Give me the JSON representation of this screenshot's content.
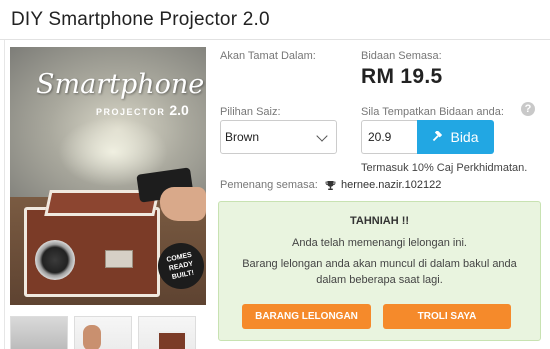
{
  "title": "DIY Smartphone Projector 2.0",
  "product_image": {
    "brand": "Smartphone",
    "subtitle": "PROJECTOR",
    "version": "2.0",
    "badge": "COMES READY BUILT!"
  },
  "thumbnails": [
    "thumbnail-1",
    "thumbnail-2",
    "thumbnail-3"
  ],
  "auction": {
    "end_label": "Akan Tamat Dalam:",
    "current_bid_label": "Bidaan Semasa:",
    "current_bid": "RM 19.5",
    "size_label": "Pilihan Saiz:",
    "size_value": "Brown",
    "place_bid_label": "Sila Tempatkan Bidaan anda:",
    "help_symbol": "?",
    "bid_value": "20.9",
    "bid_button": "Bida",
    "fee_note": "Termasuk 10% Caj Perkhidmatan.",
    "winner_label": "Pemenang semasa:",
    "winner_name": "hernee.nazir.102122"
  },
  "success": {
    "heading": "TAHNIAH !!",
    "line1": "Anda telah memenangi lelongan ini.",
    "line2": "Barang lelongan anda akan muncul di dalam bakul anda",
    "line3": "dalam beberapa saat lagi.",
    "auction_button": "BARANG LELONGAN",
    "cart_button": "TROLI SAYA"
  },
  "colors": {
    "bid_button": "#22a7e3",
    "action_button": "#f58a2b",
    "success_bg": "#e9f4df",
    "product_box": "#7b3b27"
  }
}
